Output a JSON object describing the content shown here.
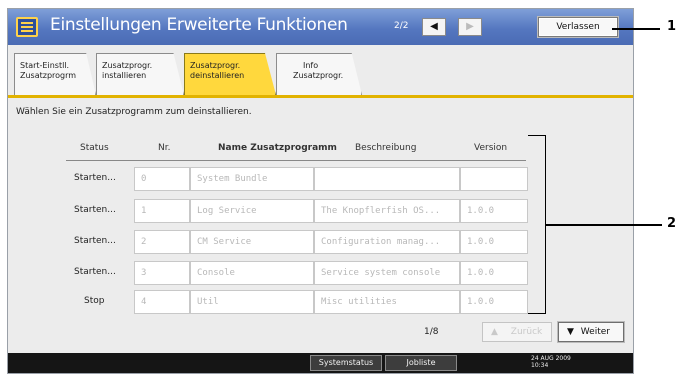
{
  "window": {
    "title": "Einstellungen Erweiterte Funktionen",
    "page_indicator": "2/2",
    "prev_icon": "◀",
    "next_icon": "▶",
    "exit_label": "Verlassen"
  },
  "tabs": [
    {
      "line1": "Start-Einstll.",
      "line2": "Zusatzprogrm",
      "active": false
    },
    {
      "line1": "Zusatzprogr.",
      "line2": "installieren",
      "active": false
    },
    {
      "line1": "Zusatzprogr.",
      "line2": "deinstallieren",
      "active": true
    },
    {
      "line1": "Info",
      "line2": "Zusatzprogr.",
      "active": false
    }
  ],
  "instruction": "Wählen Sie ein Zusatzprogramm zum deinstallieren.",
  "table": {
    "headers": [
      "Status",
      "Nr.",
      "Name Zusatzprogramm",
      "Beschreibung",
      "Version"
    ],
    "rows": [
      {
        "status": "Starten...",
        "nr": "0",
        "name": "System Bundle",
        "desc": "",
        "version": ""
      },
      {
        "status": "Starten...",
        "nr": "1",
        "name": "Log Service",
        "desc": "The Knopflerfish OS...",
        "version": "1.0.0"
      },
      {
        "status": "Starten...",
        "nr": "2",
        "name": "CM Service",
        "desc": "Configuration manag...",
        "version": "1.0.0"
      },
      {
        "status": "Starten...",
        "nr": "3",
        "name": "Console",
        "desc": "Service system console",
        "version": "1.0.0"
      },
      {
        "status": "Stop",
        "nr": "4",
        "name": "Util",
        "desc": "Misc utilities",
        "version": "1.0.0"
      }
    ]
  },
  "pagination": {
    "page": "1/8",
    "prev_label": "Zurück",
    "prev_icon": "▲",
    "next_label": "Weiter",
    "next_icon": "▼"
  },
  "bottom_bar": {
    "system_status": "Systemstatus",
    "job_list": "Jobliste",
    "date": "24 AUG 2009",
    "time": "10:34"
  },
  "callouts": [
    "1",
    "2"
  ]
}
